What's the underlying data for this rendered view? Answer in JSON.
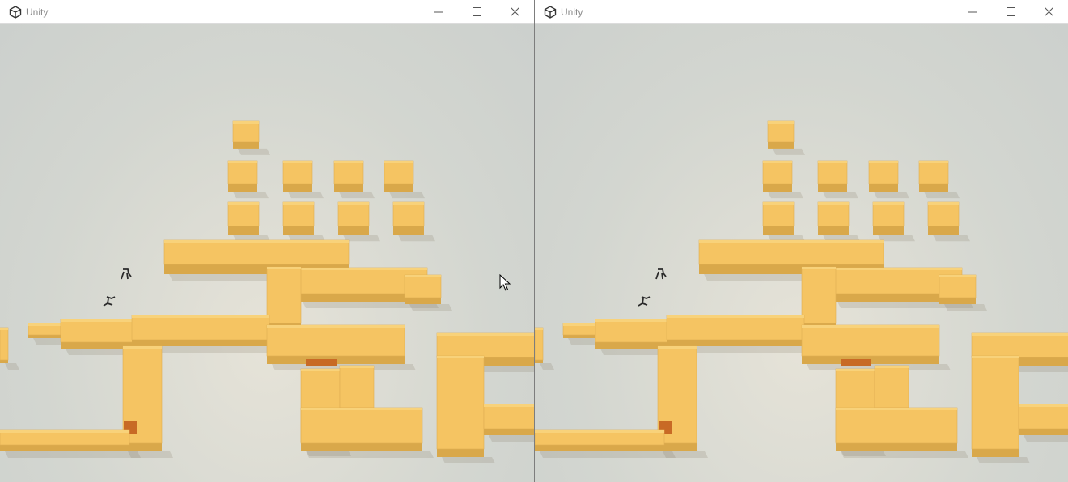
{
  "windows": [
    {
      "title": "Unity",
      "app_icon": "unity-logo-icon",
      "controls": [
        "minimize-icon",
        "maximize-icon",
        "close-icon"
      ]
    },
    {
      "title": "Unity",
      "app_icon": "unity-logo-icon",
      "controls": [
        "minimize-icon",
        "maximize-icon",
        "close-icon"
      ]
    }
  ],
  "scene": {
    "block_color": "#f5c462",
    "block_side_color": "#d9a84a",
    "block_top_light": "#f8d27a",
    "switch_color": "#c86a25",
    "floor_color": "#d4d7d0",
    "agent_color": "#2b2b2b"
  },
  "cursor": "mouse-pointer-icon"
}
